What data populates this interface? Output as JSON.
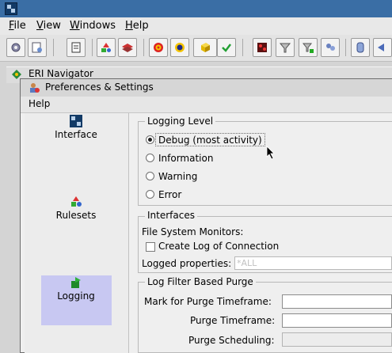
{
  "menubar": {
    "file": "File",
    "view": "View",
    "windows": "Windows",
    "help": "Help"
  },
  "toolbar": {
    "buttons": [
      "gear-icon",
      "rules-view-icon",
      "document-icon",
      "shapes-icon",
      "layers-icon",
      "target-icon",
      "refresh-cycle-icon",
      "cube-dropdown-icon",
      "checkmark-icon",
      "pattern-icon",
      "filter-icon",
      "filter-add-icon",
      "users-icon",
      "database-icon",
      "arrow-icon"
    ]
  },
  "navigator": {
    "title": "ERI Navigator"
  },
  "preferences": {
    "title": "Preferences & Settings",
    "menu_help": "Help",
    "categories": [
      "Interface",
      "Rulesets",
      "Logging"
    ],
    "selected_category": "Logging"
  },
  "logging_level": {
    "legend": "Logging Level",
    "options": [
      "Debug (most activity)",
      "Information",
      "Warning",
      "Error"
    ],
    "selected": "Debug (most activity)"
  },
  "interfaces": {
    "legend": "Interfaces",
    "fs_monitors_label": "File System Monitors:",
    "create_log_label": "Create Log of Connection",
    "create_log_checked": false,
    "logged_properties_label": "Logged properties:",
    "logged_properties_placeholder": "*ALL"
  },
  "purge": {
    "legend": "Log Filter Based Purge",
    "mark_label": "Mark for Purge Timeframe:",
    "timeframe_label": "Purge Timeframe:",
    "scheduling_label": "Purge Scheduling:"
  },
  "colors": {
    "title_bar": "#3a6ea5",
    "selection": "#c8c8f2",
    "panel": "#efefef"
  }
}
